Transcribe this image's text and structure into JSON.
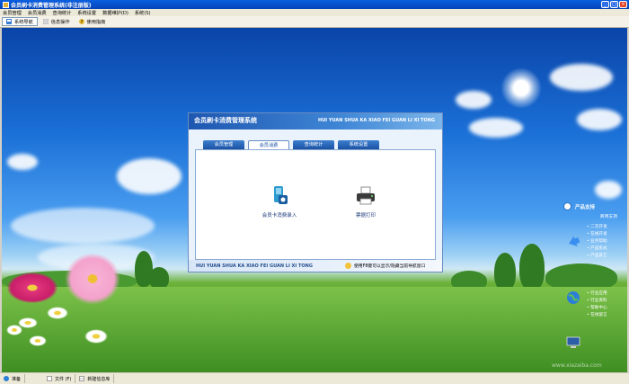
{
  "window": {
    "title": "会员刷卡消费管理系统(非注册版)",
    "buttons": [
      "_",
      "□",
      "×"
    ]
  },
  "menu": {
    "items": [
      "会员管理",
      "会员消费",
      "查询统计",
      "系统设置",
      "数据维护(D)",
      "系统(S)"
    ]
  },
  "toolbar": {
    "items": [
      {
        "label": "系统导航",
        "icon": "navigation-icon",
        "active": true
      },
      {
        "label": "信息操作",
        "icon": "info-icon",
        "active": false
      },
      {
        "label": "使用指南",
        "icon": "help-icon",
        "active": false
      }
    ]
  },
  "dialog": {
    "title": "会员刷卡消费管理系统",
    "pinyin": "HUI YUAN SHUA KA XIAO FEI GUAN LI XI TONG",
    "tabs": [
      "会员管理",
      "会员消费",
      "查询统计",
      "系统设置"
    ],
    "active_tab": 1,
    "items": [
      {
        "label": "会员卡消费录入",
        "icon": "card-entry-icon"
      },
      {
        "label": "票据打印",
        "icon": "printer-icon"
      }
    ],
    "footer_pinyin": "HUI YUAN SHUA KA XIAO FEI GUAN LI XI TONG",
    "footer_tip": "使用F8键可以显示/隐藏当前导航窗口"
  },
  "rightbar": {
    "heading": "产品支持",
    "subheading": "商用支持",
    "list1": [
      "二次开发",
      "在线开发",
      "业务帮助",
      "产品形式",
      "产品其它"
    ],
    "list2": [
      "行业应用",
      "行业资料",
      "帮助中心",
      "在线留言"
    ]
  },
  "watermark": "www.xiazaiba.com",
  "status": [
    {
      "label": "准备",
      "icon": "ready-icon"
    },
    {
      "label": "文件 (F)",
      "icon": "file-icon"
    },
    {
      "label": "新建信息库",
      "icon": "database-icon"
    }
  ]
}
